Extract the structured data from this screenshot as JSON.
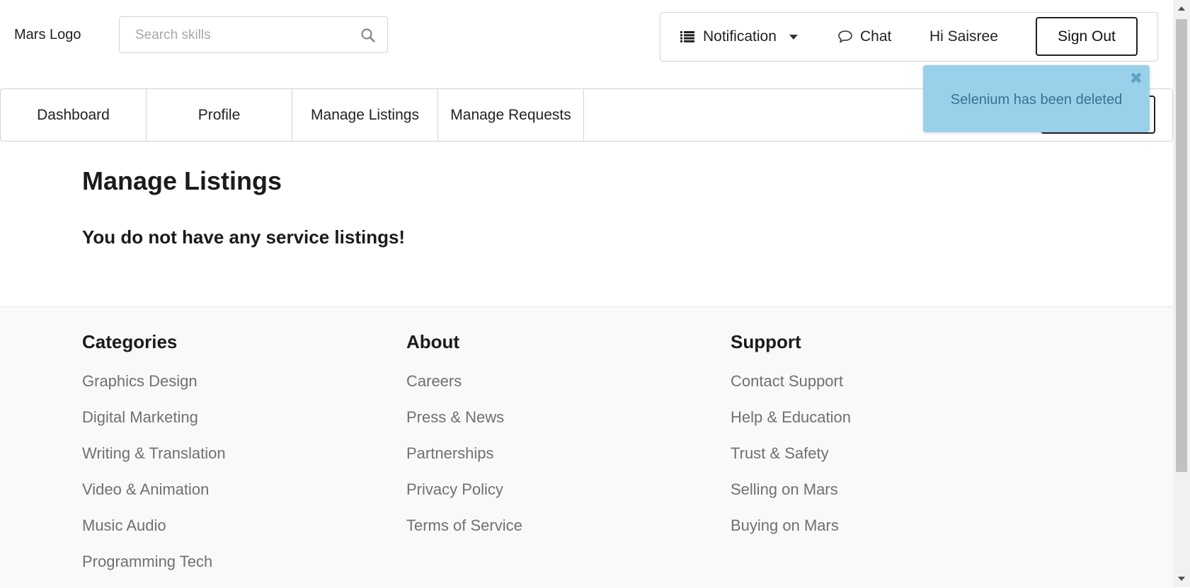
{
  "header": {
    "logo": "Mars Logo",
    "search_placeholder": "Search skills",
    "notification_label": "Notification",
    "chat_label": "Chat",
    "greeting": "Hi Saisree",
    "signout_label": "Sign Out"
  },
  "tabs": [
    {
      "label": "Dashboard"
    },
    {
      "label": "Profile"
    },
    {
      "label": "Manage Listings"
    },
    {
      "label": "Manage Requests"
    }
  ],
  "toast": {
    "message": "Selenium has been deleted",
    "close_symbol": "✖"
  },
  "main": {
    "title": "Manage Listings",
    "empty_message": "You do not have any service listings!"
  },
  "footer": {
    "categories": {
      "heading": "Categories",
      "links": [
        "Graphics Design",
        "Digital Marketing",
        "Writing & Translation",
        "Video & Animation",
        "Music Audio",
        "Programming Tech"
      ]
    },
    "about": {
      "heading": "About",
      "links": [
        "Careers",
        "Press & News",
        "Partnerships",
        "Privacy Policy",
        "Terms of Service"
      ]
    },
    "support": {
      "heading": "Support",
      "links": [
        "Contact Support",
        "Help & Education",
        "Trust & Safety",
        "Selling on Mars",
        "Buying on Mars"
      ]
    }
  },
  "colors": {
    "toast_bg": "#9ad1ea",
    "toast_text": "#3d6f8f",
    "footer_bg": "#f9f9f9",
    "footer_link": "#707070"
  },
  "icons": {
    "search": "search-icon",
    "notification": "list-icon",
    "dropdown": "caret-down-icon",
    "chat": "chat-bubble-icon",
    "close": "close-icon"
  }
}
